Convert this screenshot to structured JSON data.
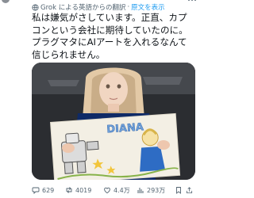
{
  "translation": {
    "label": "Grok による英語からの翻訳",
    "separator": "·",
    "show_original": "原文を表示"
  },
  "tweet": {
    "text": "私は嫌気がさしています。正直、カプコンという会社に期待していたのに。プラグマタにAIアートを入れるなんて信じられません。"
  },
  "media": {
    "drawing_name_text": "DIANA",
    "colors": {
      "background": "#2b2d31",
      "paper": "#f3efe4",
      "hair": "#e3c9a6",
      "jacket": "#0f2a66"
    }
  },
  "actions": {
    "reply_count": "629",
    "retweet_count": "4019",
    "like_count": "4.4万",
    "view_count": "293万"
  },
  "colors": {
    "text": "#0f1419",
    "muted": "#536471",
    "accent": "#1d9bf0"
  }
}
